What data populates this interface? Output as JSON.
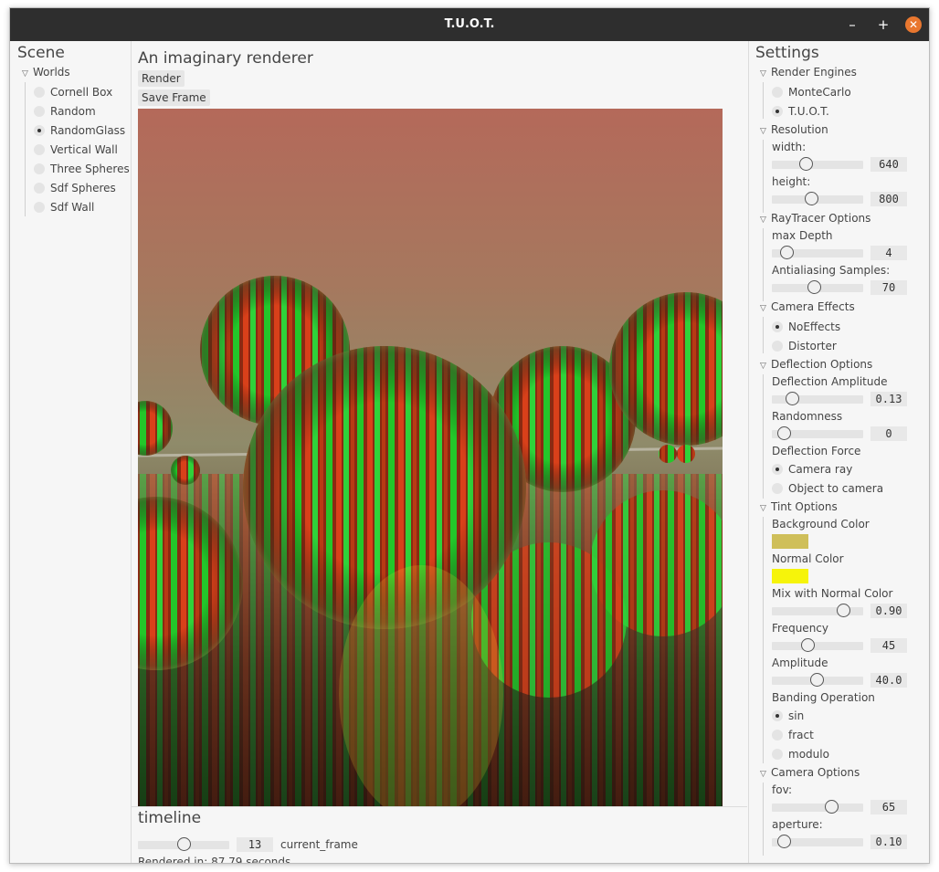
{
  "window": {
    "title": "T.U.O.T.",
    "min_icon": "minimize-icon",
    "max_icon": "maximize-icon",
    "close_icon": "close-icon",
    "min_glyph": "–",
    "max_glyph": "+",
    "close_glyph": "✕"
  },
  "scene": {
    "heading": "Scene",
    "tree_label": "Worlds",
    "items": [
      {
        "label": "Cornell Box",
        "selected": false
      },
      {
        "label": "Random",
        "selected": false
      },
      {
        "label": "RandomGlass",
        "selected": true
      },
      {
        "label": "Vertical Wall",
        "selected": false
      },
      {
        "label": "Three Spheres",
        "selected": false
      },
      {
        "label": "Sdf Spheres",
        "selected": false
      },
      {
        "label": "Sdf Wall",
        "selected": false
      }
    ]
  },
  "main": {
    "title": "An imaginary renderer",
    "render_button": "Render",
    "save_frame_button": "Save Frame",
    "timeline": {
      "heading": "timeline",
      "value": "13",
      "fraction": 0.5,
      "label": "current_frame",
      "status": "Rendered in: 87.79 seconds"
    }
  },
  "settings": {
    "heading": "Settings",
    "render_engines": {
      "label": "Render Engines",
      "options": [
        "MonteCarlo",
        "T.U.O.T."
      ],
      "selected": 1
    },
    "resolution": {
      "label": "Resolution",
      "width_label": "width:",
      "width_value": "640",
      "width_fraction": 0.35,
      "height_label": "height:",
      "height_value": "800",
      "height_fraction": 0.42
    },
    "raytracer": {
      "label": "RayTracer Options",
      "max_depth_label": "max Depth",
      "max_depth_value": "4",
      "max_depth_fraction": 0.1,
      "aa_label": "Antialiasing Samples:",
      "aa_value": "70",
      "aa_fraction": 0.46
    },
    "camera_effects": {
      "label": "Camera Effects",
      "options": [
        "NoEffects",
        "Distorter"
      ],
      "selected": 0
    },
    "deflection": {
      "label": "Deflection Options",
      "amplitude_label": "Deflection Amplitude",
      "amplitude_value": "0.13",
      "amplitude_fraction": 0.18,
      "randomness_label": "Randomness",
      "randomness_value": "0",
      "randomness_fraction": 0.07,
      "force_label": "Deflection Force",
      "force_options": [
        "Camera ray",
        "Object to camera"
      ],
      "force_selected": 0
    },
    "tint": {
      "label": "Tint Options",
      "bg_label": "Background Color",
      "bg_color": "#cfbf5a",
      "normal_label": "Normal Color",
      "normal_color": "#f6f40a",
      "mix_label": "Mix with Normal Color",
      "mix_value": "0.90",
      "mix_fraction": 0.84,
      "freq_label": "Frequency",
      "freq_value": "45",
      "freq_fraction": 0.38,
      "amp_label": "Amplitude",
      "amp_value": "40.0",
      "amp_fraction": 0.49,
      "banding_label": "Banding Operation",
      "banding_options": [
        "sin",
        "fract",
        "modulo"
      ],
      "banding_selected": 0
    },
    "camera": {
      "label": "Camera Options",
      "fov_label": "fov:",
      "fov_value": "65",
      "fov_fraction": 0.68,
      "aperture_label": "aperture:",
      "aperture_value": "0.10",
      "aperture_fraction": 0.07
    }
  }
}
